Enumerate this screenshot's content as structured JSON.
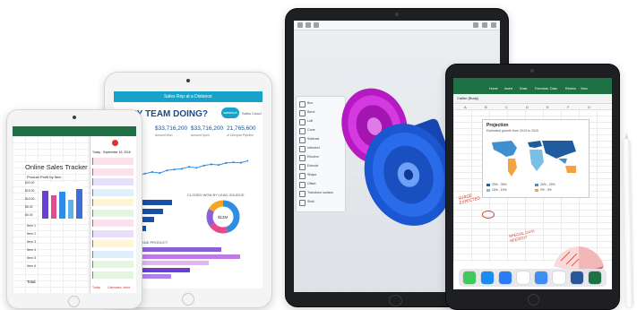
{
  "ipad_mini": {
    "sheet_title": "Online Sales Tracker",
    "chart_title": "Product Profit by Item",
    "y_ticks": [
      "$20.00",
      "$15.00",
      "$10.00",
      "$5.00",
      "$0.00"
    ],
    "bars": [
      0.82,
      0.68,
      0.78,
      0.55,
      0.86
    ],
    "bar_colors": [
      "#6b3fd6",
      "#e44b8c",
      "#2f8de4",
      "#5fb0ef",
      "#3e6fd6"
    ],
    "row_labels": [
      "Item 1",
      "Item 2",
      "Item 3",
      "Item 4",
      "Item 5",
      "Item 6"
    ],
    "total_label": "Total",
    "calendar_date": "Today - September 15, 2016",
    "calendar_footer": [
      "Today",
      "Calendars",
      "Inbox"
    ]
  },
  "ipad_air": {
    "top_bar": "Sales Rep at a Distance",
    "heading": "S MY TEAM DOING?",
    "brand": "salesforce",
    "brand_sub": "Sales Cloud",
    "kpis": [
      {
        "value": "386",
        "label": ""
      },
      {
        "value": "$33,716,200",
        "label": "Amount Won"
      },
      {
        "value": "$33,716,200",
        "label": "Amount Open"
      },
      {
        "value": "21,765,600",
        "label": "of Lifecycle Pipeline"
      }
    ],
    "section_line": "TIME YEAR",
    "section_closed": "CLOSED",
    "section_lead": "CLOSED WON BY LEAD SOURCE",
    "donut_center": "$12M",
    "section_region": "BY REGION AND PRODUCT",
    "line_points": [
      0.35,
      0.4,
      0.38,
      0.45,
      0.5,
      0.47,
      0.55,
      0.58,
      0.6,
      0.66,
      0.63,
      0.7,
      0.74,
      0.72,
      0.78,
      0.8,
      0.79,
      0.85
    ],
    "hbars": [
      0.92,
      0.75,
      0.6,
      0.45
    ],
    "donut": [
      {
        "value": 0.45,
        "color": "#2f8de4"
      },
      {
        "value": 0.2,
        "color": "#e44b8c"
      },
      {
        "value": 0.18,
        "color": "#8b5fd6"
      },
      {
        "value": 0.17,
        "color": "#f5a623"
      }
    ],
    "region_bars": [
      0.8,
      0.95,
      0.7,
      0.55,
      0.4
    ],
    "region_colors": [
      "#8b5fd6",
      "#c07ae4",
      "#e0b6f2",
      "#6b3fd6",
      "#b084e6"
    ]
  },
  "ipad_pro_large": {
    "toolbar_labels": [
      "Box",
      "Bend",
      "Loft",
      "Cone",
      "Subtract",
      "Intersect",
      "Revolve",
      "Extrude",
      "Shape",
      "Offset",
      "Transform surface",
      "Shell"
    ],
    "wheel_colors": [
      "#c41bd1",
      "#1e63e0"
    ]
  },
  "ipad_pro_small": {
    "ribbon_tabs": [
      "Home",
      "Insert",
      "Draw",
      "Formulas",
      "Data",
      "Review",
      "View"
    ],
    "font_name": "Calibri (Body)",
    "columns": [
      "A",
      "B",
      "C",
      "D",
      "E",
      "F",
      "G"
    ],
    "chart_title": "Projection",
    "chart_sub": "Estimated growth from 2015 to 2020",
    "legend": [
      "29% - 39%",
      "20% - 29%",
      "10% - 19%",
      "0% - 9%"
    ],
    "legend_colors": [
      "#1f5c9e",
      "#3f8fd1",
      "#7cbfe6",
      "#f4a340"
    ],
    "handwriting_1": "SURGE EXPECTED",
    "handwriting_2": "SPECIAL DATA NEEDED?",
    "dock_apps": [
      "Messages",
      "Safari",
      "Mail",
      "Music",
      "Files",
      "Photos",
      "Word",
      "Excel"
    ],
    "dock_colors": [
      "#40c85a",
      "#1a8cf0",
      "#2b7cf4",
      "#ffffff",
      "#3d8df5",
      "#ffffff",
      "#2b579a",
      "#1e7145"
    ]
  }
}
